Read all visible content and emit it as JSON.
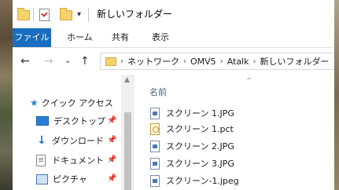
{
  "window": {
    "title": "新しいフォルダー"
  },
  "quick_access_toolbar": {
    "dropdown_glyph": "▾"
  },
  "ribbon": {
    "file_tab": "ファイル",
    "tabs": [
      "ホーム",
      "共有",
      "表示"
    ]
  },
  "nav_buttons": {
    "back": "←",
    "forward": "→",
    "recent": "⌄",
    "up": "↑"
  },
  "address": {
    "separator": "›",
    "crumbs": [
      "ネットワーク",
      "OMV5",
      "Atalk",
      "新しいフォルダー"
    ]
  },
  "nav_pane": {
    "quick_access": "クイック アクセス",
    "items": [
      {
        "label": "デスクトップ",
        "icon": "desktop-icon"
      },
      {
        "label": "ダウンロード",
        "icon": "download-icon"
      },
      {
        "label": "ドキュメント",
        "icon": "documents-icon"
      },
      {
        "label": "ピクチャ",
        "icon": "pictures-icon"
      }
    ],
    "pin_glyph": "📌"
  },
  "content": {
    "column_name": "名前",
    "sort_glyph": "^",
    "files": [
      {
        "name": "スクリーン 1.JPG",
        "icon": "jpg-file-icon"
      },
      {
        "name": "スクリーン 1.pct",
        "icon": "pct-file-icon"
      },
      {
        "name": "スクリーン 2.JPG",
        "icon": "jpg-file-icon"
      },
      {
        "name": "スクリーン 3.JPG",
        "icon": "jpg-file-icon"
      },
      {
        "name": "スクリーン-1.jpeg",
        "icon": "jpg-file-icon"
      }
    ]
  },
  "colors": {
    "accent": "#1a6ec0",
    "folder": "#f6d26a"
  }
}
